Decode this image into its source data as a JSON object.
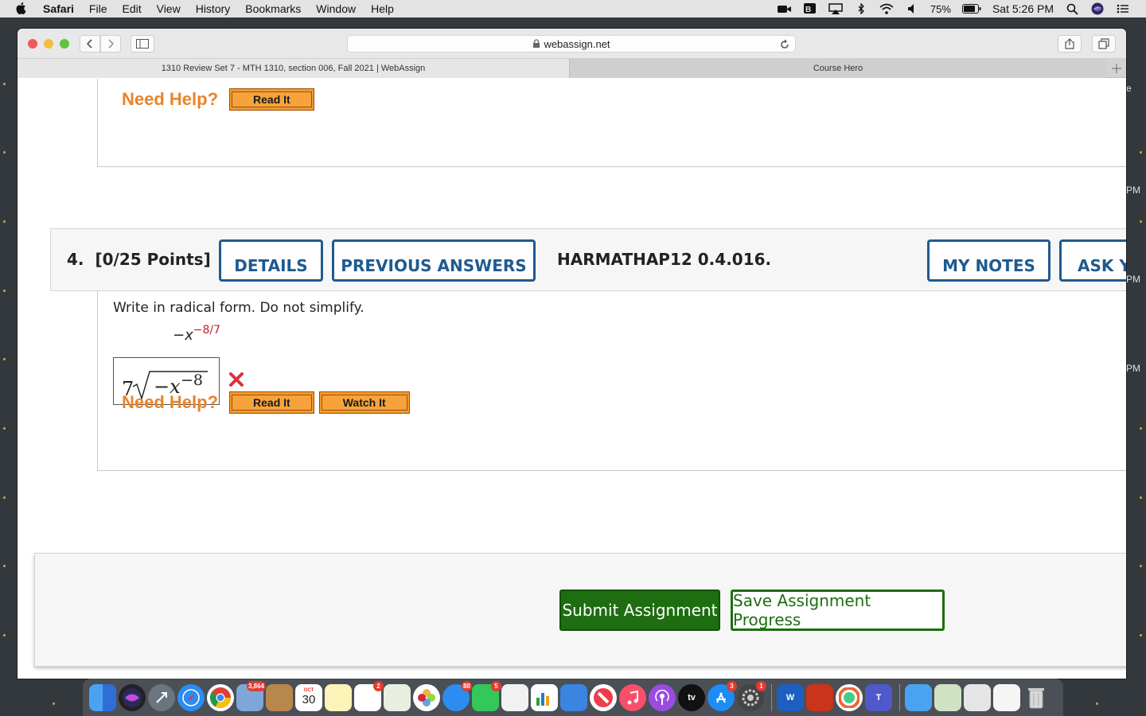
{
  "menubar": {
    "app_name": "Safari",
    "menus": [
      "File",
      "Edit",
      "View",
      "History",
      "Bookmarks",
      "Window",
      "Help"
    ],
    "battery": "75%",
    "clock": "Sat 5:26 PM",
    "status_icons": [
      "facetime-camera-icon",
      "bluetooth-device-icon",
      "airplay-icon",
      "bluetooth-icon",
      "wifi-icon",
      "volume-icon",
      "battery-icon",
      "spotlight-icon",
      "siri-icon",
      "control-center-icon"
    ]
  },
  "browser": {
    "address": "webassign.net",
    "tabs": [
      {
        "label": "1310 Review Set 7 - MTH 1310, section 006, Fall 2021 | WebAssign",
        "active": true
      },
      {
        "label": "Course Hero",
        "active": false
      }
    ]
  },
  "previous_question": {
    "need_help_label": "Need Help?",
    "read_it_label": "Read It"
  },
  "question": {
    "number": "4.",
    "points": "[0/25 Points]",
    "details_label": "DETAILS",
    "previous_answers_label": "PREVIOUS ANSWERS",
    "code": "HARMATHAP12 0.4.016.",
    "my_notes_label": "MY NOTES",
    "ask_label": "ASK YO",
    "prompt": "Write in radical form. Do not simplify.",
    "expression_base": "−x",
    "expression_exponent": "−8/7",
    "answer_index": "7",
    "answer_radicand": "−x",
    "answer_exponent": "−8",
    "answer_status": "incorrect",
    "need_help_label": "Need Help?",
    "read_it_label": "Read It",
    "watch_it_label": "Watch It"
  },
  "footer": {
    "submit_label": "Submit Assignment",
    "save_label": "Save Assignment Progress"
  },
  "edge_fragments": [
    "e",
    "PM",
    "PM",
    "PM"
  ],
  "dock": {
    "badges": {
      "mail": "3,864",
      "calendar_month": "OCT",
      "calendar_day": "30",
      "reminders": "2",
      "messages": "88",
      "facetime": "5",
      "appstore": "3",
      "settings": "1"
    },
    "tv_label": "tv",
    "word_label": "W",
    "teams_label": "T"
  },
  "colors": {
    "webassign_blue": "#1f5a90",
    "help_orange": "#e8842b",
    "submit_green": "#1e6e11",
    "wrong_red": "#d8323c"
  }
}
